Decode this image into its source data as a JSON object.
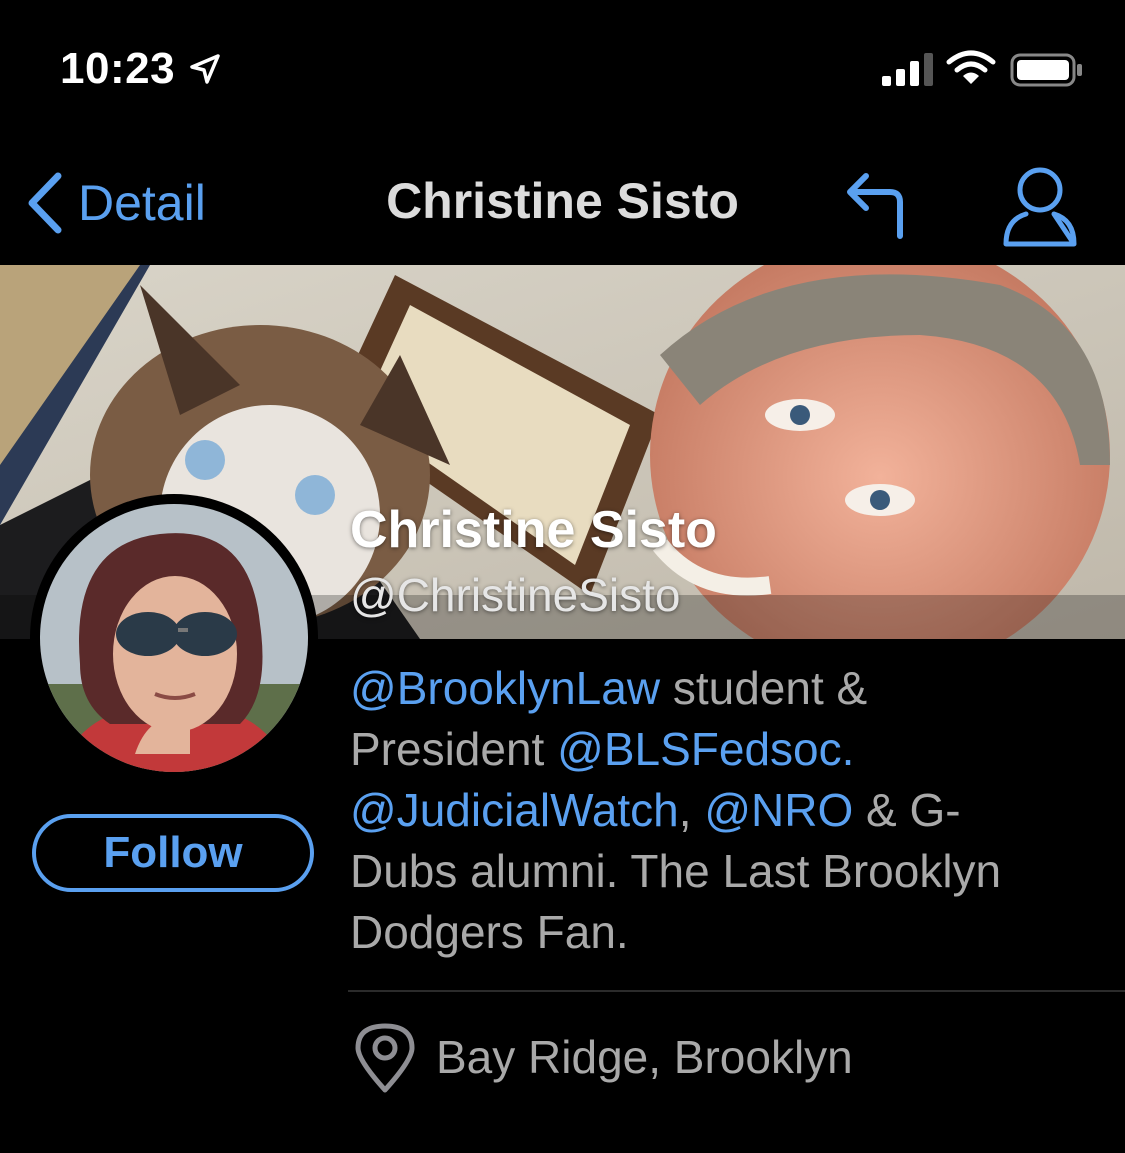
{
  "status_bar": {
    "time": "10:23",
    "icons": [
      "location-arrow-icon",
      "cellular-signal-icon",
      "wifi-icon",
      "battery-icon"
    ]
  },
  "nav": {
    "back_label": "Detail",
    "title": "Christine Sisto",
    "icons": [
      "chevron-left-icon",
      "reply-icon",
      "person-icon"
    ]
  },
  "profile": {
    "display_name": "Christine Sisto",
    "handle": "@ChristineSisto",
    "follow_label": "Follow",
    "bio": {
      "line1_mention": "@BrooklynLaw",
      "line1_text": " student &",
      "line2_text": "President ",
      "line2_mention": "@BLSFedsoc.",
      "line3_mention1": "@JudicialWatch",
      "line3_text1": ", ",
      "line3_mention2": "@NRO",
      "line3_text2": " & G-",
      "line4_text": "Dubs alumni. The Last Brooklyn",
      "line5_text": "Dodgers Fan."
    },
    "location": "Bay Ridge, Brooklyn",
    "location_icon": "map-pin-icon"
  },
  "colors": {
    "background": "#000000",
    "accent": "#5aa0f0",
    "secondary_text": "#a9a9a9",
    "title_text": "#dcdcdc"
  }
}
